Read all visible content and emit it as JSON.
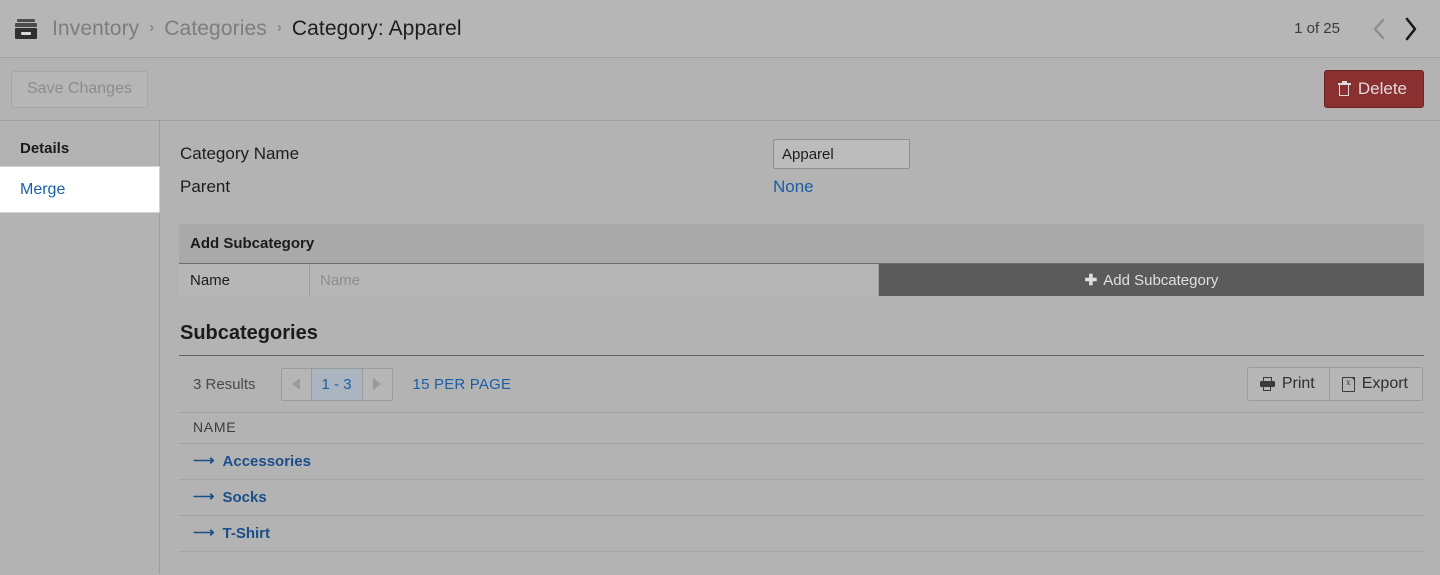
{
  "breadcrumb": {
    "icon": "archive-box-icon",
    "items": [
      {
        "label": "Inventory",
        "current": false
      },
      {
        "label": "Categories",
        "current": false
      },
      {
        "label": "Category: Apparel",
        "current": true
      }
    ],
    "separator": "›",
    "pager": {
      "count_label": "1 of 25",
      "prev_icon": "chevron-left-icon",
      "next_icon": "chevron-right-icon"
    }
  },
  "toolbar": {
    "save_label": "Save Changes",
    "save_disabled": true,
    "delete_label": "Delete",
    "delete_icon": "trash-icon",
    "delete_color": "#8b3030"
  },
  "sidebar": {
    "items": [
      {
        "label": "Details",
        "state": "active"
      },
      {
        "label": "Merge",
        "state": "hovered"
      }
    ]
  },
  "form": {
    "fields": [
      {
        "label": "Category Name",
        "type": "text",
        "value": "Apparel"
      },
      {
        "label": "Parent",
        "type": "link",
        "value": "None"
      }
    ]
  },
  "add_subcategory": {
    "header": "Add Subcategory",
    "name_label": "Name",
    "name_placeholder": "Name",
    "name_value": "",
    "button_label": "Add Subcategory",
    "button_icon": "plus-icon"
  },
  "subcategories": {
    "title": "Subcategories",
    "results_label": "3 Results",
    "pager": {
      "prev_icon": "triangle-left-icon",
      "range_label": "1 - 3",
      "next_icon": "triangle-right-icon"
    },
    "per_page_label": "15 PER PAGE",
    "print_label": "Print",
    "print_icon": "printer-icon",
    "export_label": "Export",
    "export_icon": "spreadsheet-icon",
    "columns": [
      "NAME"
    ],
    "rows": [
      {
        "name": "Accessories",
        "icon": "arrow-right-icon"
      },
      {
        "name": "Socks",
        "icon": "arrow-right-icon"
      },
      {
        "name": "T-Shirt",
        "icon": "arrow-right-icon"
      }
    ]
  },
  "colors": {
    "page_background": "#b3b3b3",
    "link": "#1a5fa8",
    "row_link": "#1a4f8a",
    "danger": "#8b3030",
    "button_dark": "#5b5b5b",
    "pager_active": "#aab5c0"
  }
}
